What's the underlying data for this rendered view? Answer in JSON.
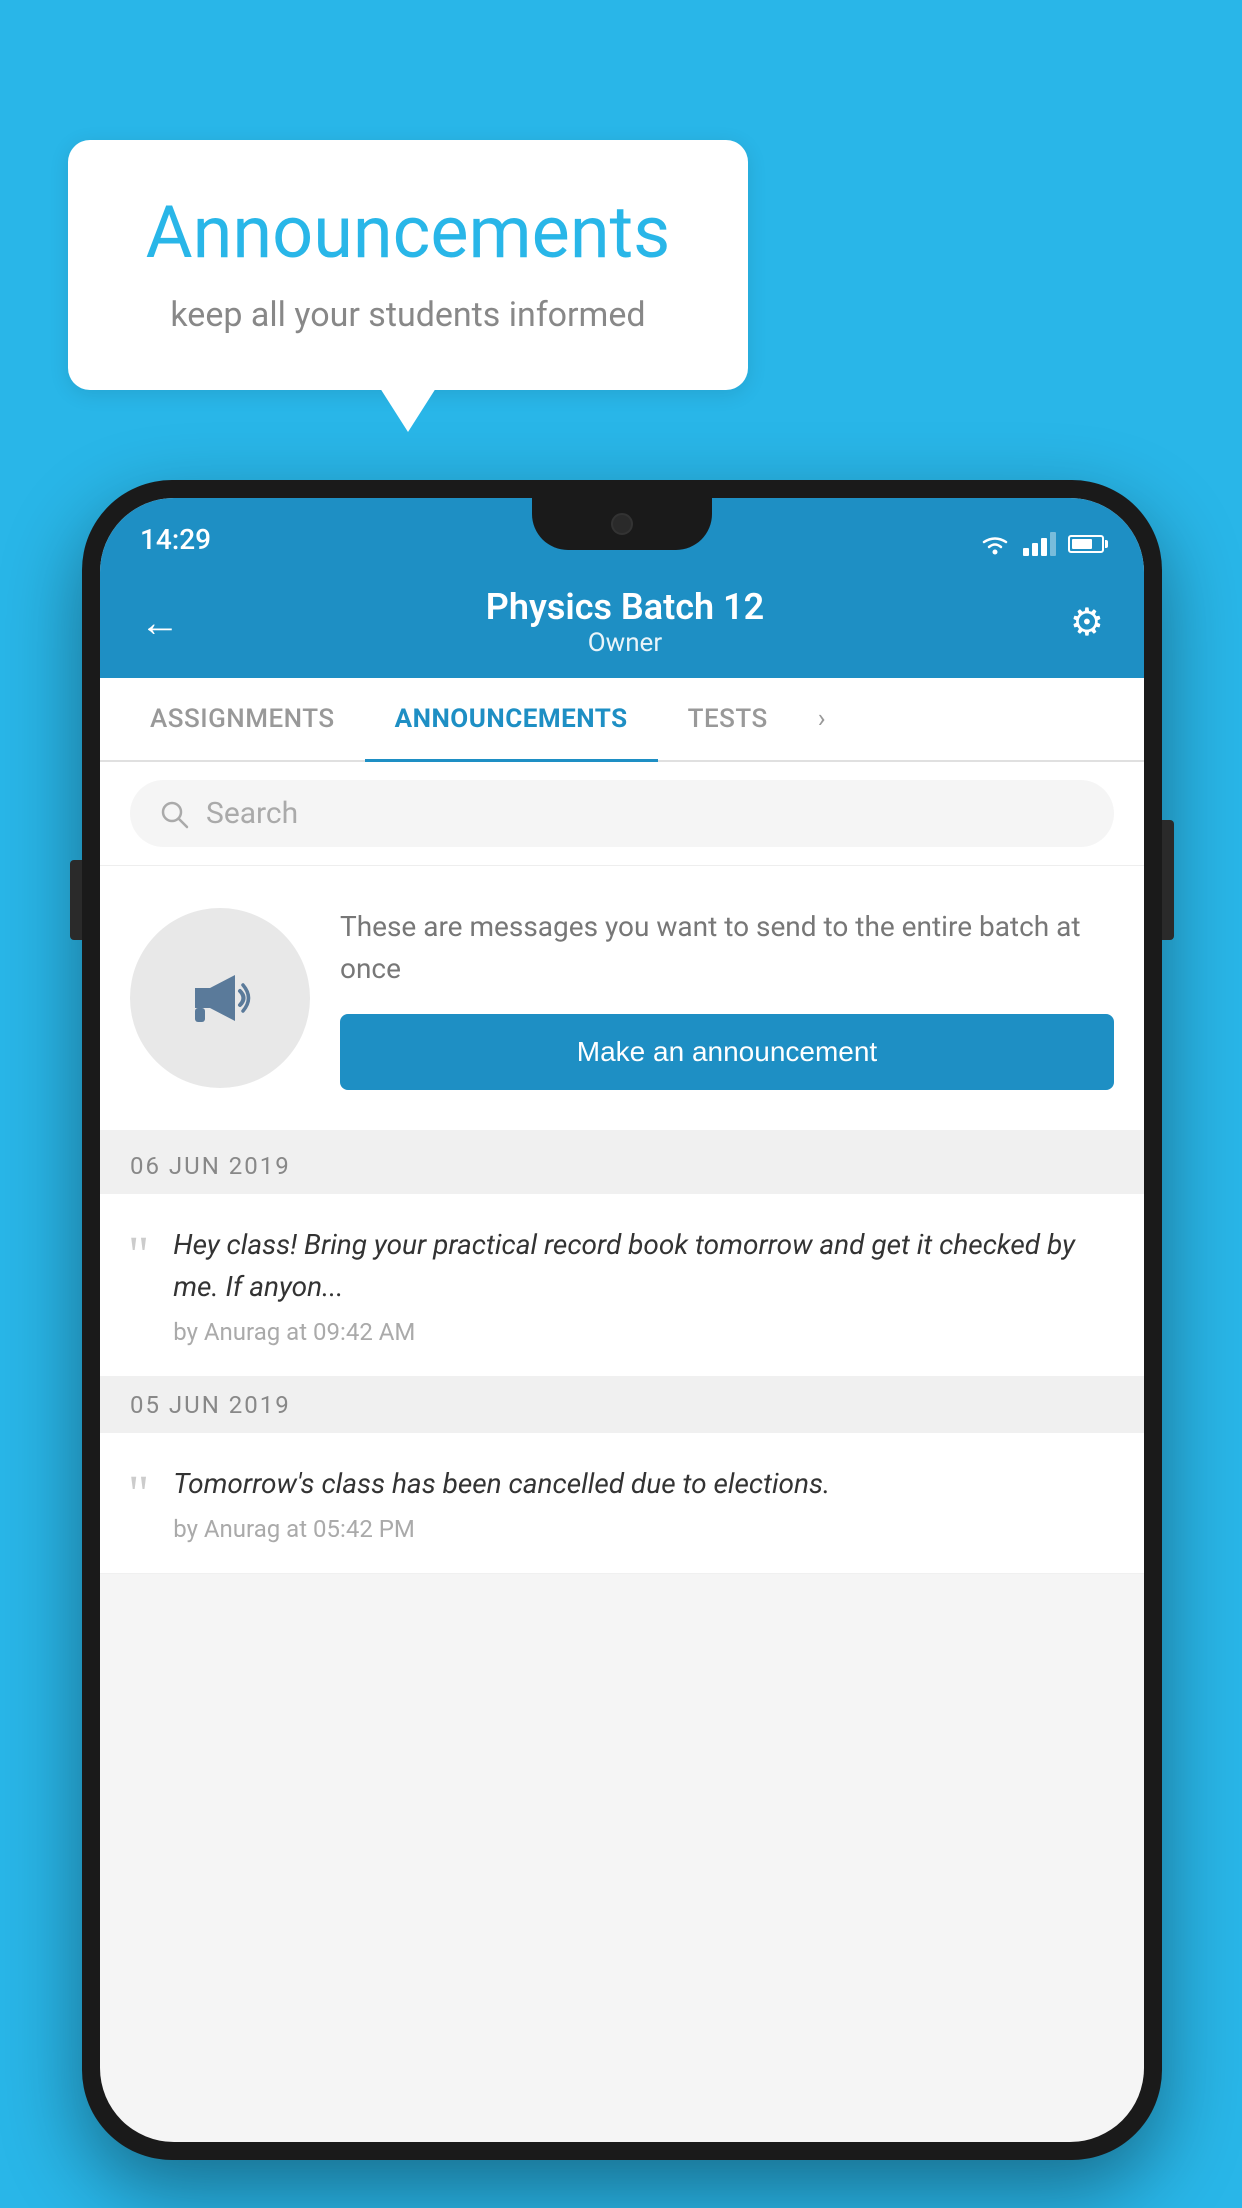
{
  "background_color": "#29b6e8",
  "speech_bubble": {
    "title": "Announcements",
    "subtitle": "keep all your students informed"
  },
  "phone": {
    "status_bar": {
      "time": "14:29"
    },
    "header": {
      "title": "Physics Batch 12",
      "subtitle": "Owner",
      "back_label": "←",
      "settings_label": "⚙"
    },
    "tabs": [
      {
        "label": "ASSIGNMENTS",
        "active": false
      },
      {
        "label": "ANNOUNCEMENTS",
        "active": true
      },
      {
        "label": "TESTS",
        "active": false
      }
    ],
    "search": {
      "placeholder": "Search"
    },
    "intro_section": {
      "description": "These are messages you want to send to the entire batch at once",
      "button_label": "Make an announcement"
    },
    "announcements": [
      {
        "date": "06  JUN  2019",
        "text": "Hey class! Bring your practical record book tomorrow and get it checked by me. If anyon...",
        "meta": "by Anurag at 09:42 AM"
      },
      {
        "date": "05  JUN  2019",
        "text": "Tomorrow's class has been cancelled due to elections.",
        "meta": "by Anurag at 05:42 PM"
      }
    ]
  }
}
